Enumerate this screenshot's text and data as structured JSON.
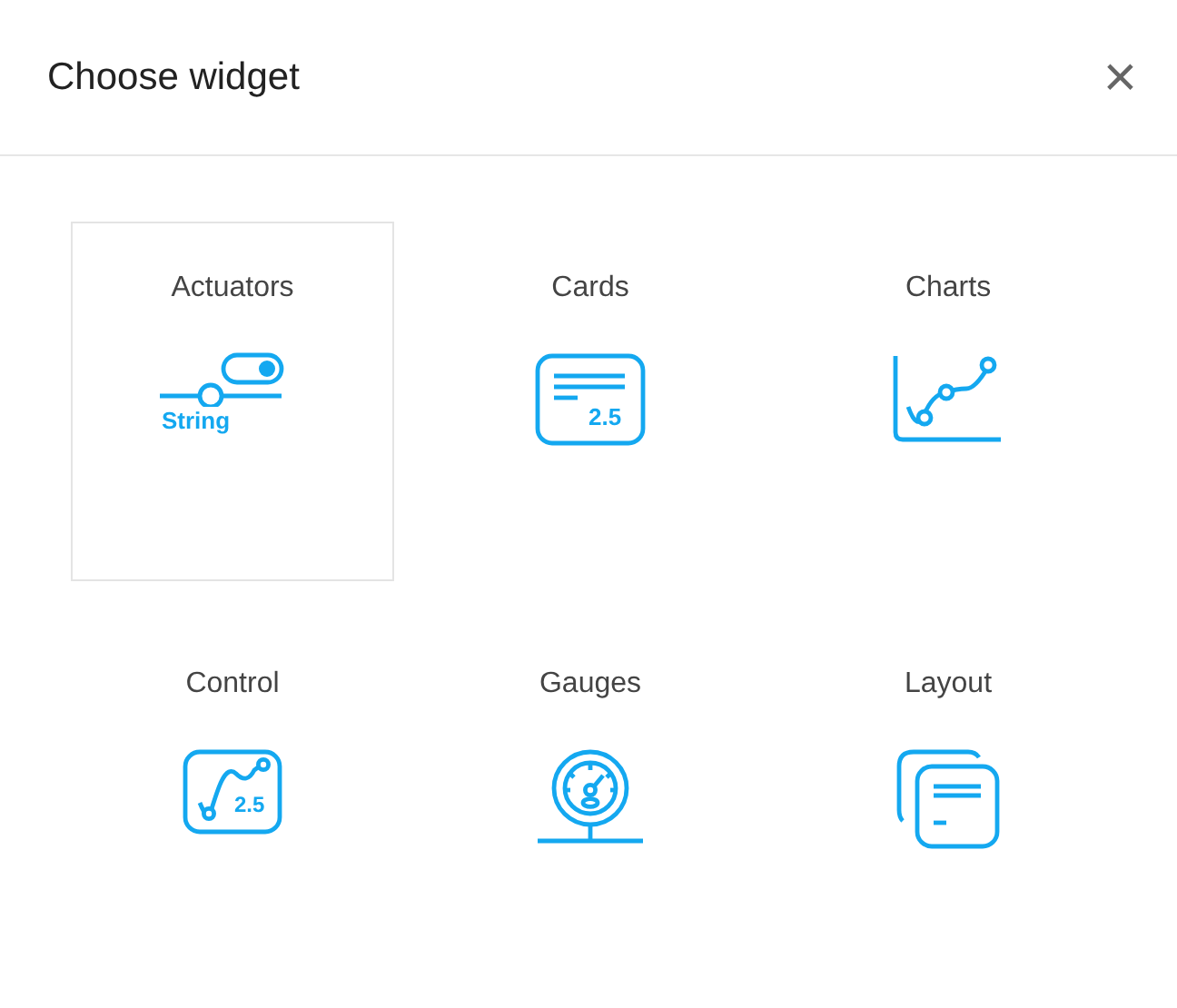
{
  "dialog": {
    "title": "Choose widget",
    "close": "×"
  },
  "tiles": [
    {
      "kind": "actuators",
      "label": "Actuators",
      "icon_text": "String",
      "selected": true
    },
    {
      "kind": "cards",
      "label": "Cards",
      "icon_text": "2.5",
      "selected": false
    },
    {
      "kind": "charts",
      "label": "Charts",
      "selected": false
    },
    {
      "kind": "control",
      "label": "Control",
      "icon_text": "2.5",
      "selected": false
    },
    {
      "kind": "gauges",
      "label": "Gauges",
      "selected": false
    },
    {
      "kind": "layout",
      "label": "Layout",
      "selected": false
    }
  ]
}
